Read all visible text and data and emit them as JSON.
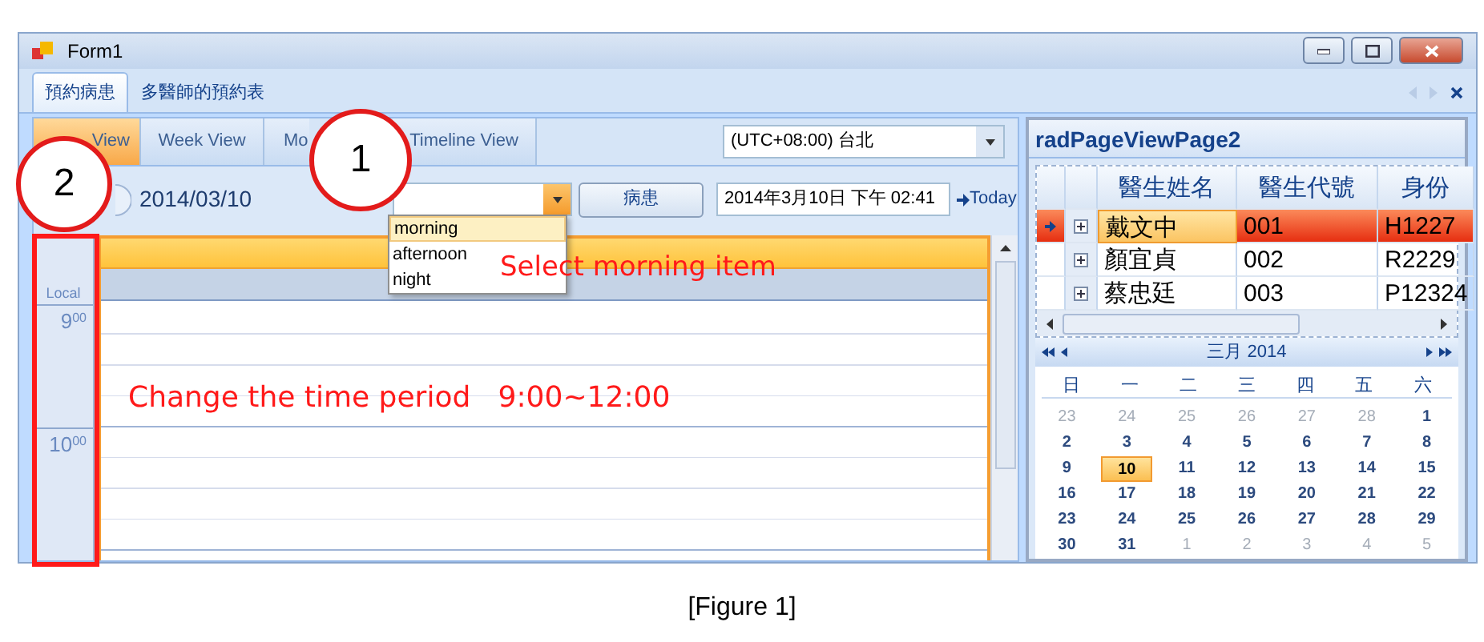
{
  "window": {
    "title": "Form1"
  },
  "tabs": [
    {
      "label": "預約病患",
      "selected": true
    },
    {
      "label": "多醫師的預約表",
      "selected": false
    }
  ],
  "scheduler": {
    "view_tabs": [
      {
        "label": "View",
        "selected": true
      },
      {
        "label": "Week View",
        "selected": false
      },
      {
        "label": "Mo",
        "selected": false
      },
      {
        "label": "Timeline View",
        "selected": false
      }
    ],
    "timezone": "(UTC+08:00) 台北",
    "date": "2014/03/10",
    "period_options": [
      {
        "label": "morning",
        "selected": true
      },
      {
        "label": "afternoon",
        "selected": false
      },
      {
        "label": "night",
        "selected": false
      }
    ],
    "patient_button": "病患",
    "datetime": "2014年3月10日 下午 02:41",
    "today_link": "Today",
    "ruler_label": "Local",
    "hours": [
      "9$^{00}$",
      "10$^{00}$"
    ]
  },
  "side_panel": {
    "title": "radPageViewPage2",
    "grid": {
      "columns": [
        "醫生姓名",
        "醫生代號",
        "身份"
      ],
      "rows": [
        {
          "cells": [
            "戴文中",
            "001",
            "H1227"
          ],
          "selected": true
        },
        {
          "cells": [
            "顏宜貞",
            "002",
            "R2229"
          ],
          "selected": false
        },
        {
          "cells": [
            "蔡忠廷",
            "003",
            "P12324"
          ],
          "selected": false
        }
      ]
    },
    "calendar": {
      "title": "三月 2014",
      "weekdays": [
        "日",
        "一",
        "二",
        "三",
        "四",
        "五",
        "六"
      ],
      "days": [
        {
          "label": "23",
          "other_month": true,
          "selected": false
        },
        {
          "label": "24",
          "other_month": true,
          "selected": false
        },
        {
          "label": "25",
          "other_month": true,
          "selected": false
        },
        {
          "label": "26",
          "other_month": true,
          "selected": false
        },
        {
          "label": "27",
          "other_month": true,
          "selected": false
        },
        {
          "label": "28",
          "other_month": true,
          "selected": false
        },
        {
          "label": "1",
          "other_month": false,
          "selected": false
        },
        {
          "label": "2",
          "other_month": false,
          "selected": false
        },
        {
          "label": "3",
          "other_month": false,
          "selected": false
        },
        {
          "label": "4",
          "other_month": false,
          "selected": false
        },
        {
          "label": "5",
          "other_month": false,
          "selected": false
        },
        {
          "label": "6",
          "other_month": false,
          "selected": false
        },
        {
          "label": "7",
          "other_month": false,
          "selected": false
        },
        {
          "label": "8",
          "other_month": false,
          "selected": false
        },
        {
          "label": "9",
          "other_month": false,
          "selected": false
        },
        {
          "label": "10",
          "other_month": false,
          "selected": true
        },
        {
          "label": "11",
          "other_month": false,
          "selected": false
        },
        {
          "label": "12",
          "other_month": false,
          "selected": false
        },
        {
          "label": "13",
          "other_month": false,
          "selected": false
        },
        {
          "label": "14",
          "other_month": false,
          "selected": false
        },
        {
          "label": "15",
          "other_month": false,
          "selected": false
        },
        {
          "label": "16",
          "other_month": false,
          "selected": false
        },
        {
          "label": "17",
          "other_month": false,
          "selected": false
        },
        {
          "label": "18",
          "other_month": false,
          "selected": false
        },
        {
          "label": "19",
          "other_month": false,
          "selected": false
        },
        {
          "label": "20",
          "other_month": false,
          "selected": false
        },
        {
          "label": "21",
          "other_month": false,
          "selected": false
        },
        {
          "label": "22",
          "other_month": false,
          "selected": false
        },
        {
          "label": "23",
          "other_month": false,
          "selected": false
        },
        {
          "label": "24",
          "other_month": false,
          "selected": false
        },
        {
          "label": "25",
          "other_month": false,
          "selected": false
        },
        {
          "label": "26",
          "other_month": false,
          "selected": false
        },
        {
          "label": "27",
          "other_month": false,
          "selected": false
        },
        {
          "label": "28",
          "other_month": false,
          "selected": false
        },
        {
          "label": "29",
          "other_month": false,
          "selected": false
        },
        {
          "label": "30",
          "other_month": false,
          "selected": false
        },
        {
          "label": "31",
          "other_month": false,
          "selected": false
        },
        {
          "label": "1",
          "other_month": true,
          "selected": false
        },
        {
          "label": "2",
          "other_month": true,
          "selected": false
        },
        {
          "label": "3",
          "other_month": true,
          "selected": false
        },
        {
          "label": "4",
          "other_month": true,
          "selected": false
        },
        {
          "label": "5",
          "other_month": true,
          "selected": false
        }
      ]
    }
  },
  "annotations": [
    {
      "kind": "circle",
      "label": "1"
    },
    {
      "kind": "circle",
      "label": "2"
    },
    {
      "kind": "note",
      "text": "Select morning item"
    },
    {
      "kind": "note",
      "text": "Change the time period   9:00~12:00"
    },
    {
      "kind": "frame"
    }
  ],
  "caption": "[Figure 1]"
}
